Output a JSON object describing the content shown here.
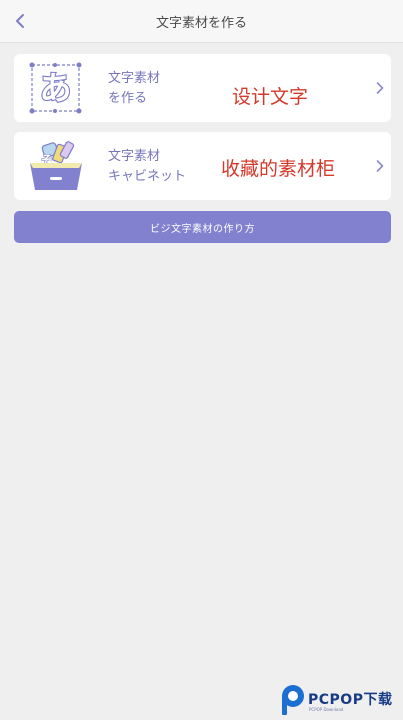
{
  "header": {
    "title": "文字素材を作る",
    "back_icon": "chevron-left-icon"
  },
  "cards": [
    {
      "line1": "文字素材",
      "line2": "を作る",
      "overlay": "设计文字",
      "icon": "hiragana-a-sticker-icon"
    },
    {
      "line1": "文字素材",
      "line2": "キャビネット",
      "overlay": "收藏的素材柜",
      "icon": "sticker-cabinet-icon"
    }
  ],
  "cta": {
    "label": "ビジ文字素材の作り方"
  },
  "watermark": {
    "brand": "PCPOP下载",
    "sub": "PCPOP Download"
  },
  "colors": {
    "accent": "#8181d0",
    "label": "#7576b8",
    "overlay_red": "#d43a2c",
    "background": "#efeff0"
  }
}
